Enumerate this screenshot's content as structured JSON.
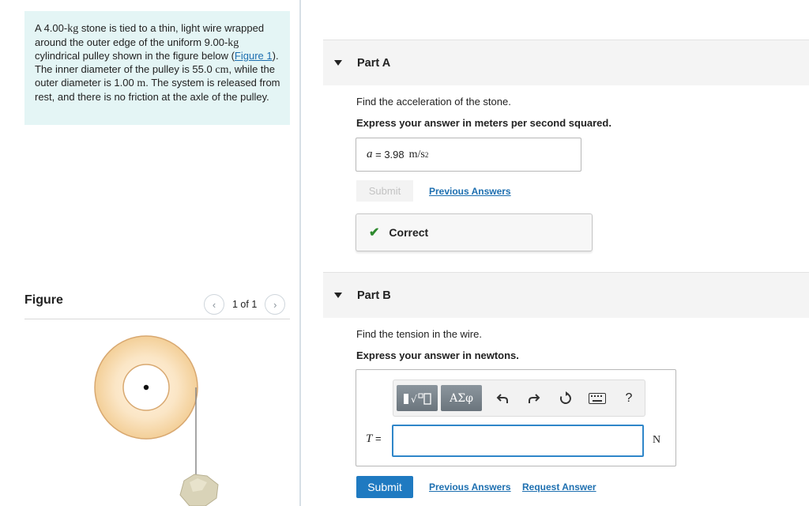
{
  "problem": {
    "text_1": "A 4.00-",
    "unit_kg_1": "kg",
    "text_2": " stone is tied to a thin, light wire wrapped around the outer edge of the uniform 9.00-",
    "unit_kg_2": "kg",
    "text_3": " cylindrical pulley shown in the figure below (",
    "figure_link": "Figure 1",
    "text_4": "). The inner diameter of the pulley is 55.0 ",
    "unit_cm": "cm",
    "text_5": ", while the outer diameter is 1.00 ",
    "unit_m": "m",
    "text_6": ". The system is released from rest, and there is no friction at the axle of the pulley."
  },
  "figure": {
    "title": "Figure",
    "pager_text": "1 of 1",
    "prev_icon": "chevron-left-icon",
    "next_icon": "chevron-right-icon",
    "colors": {
      "pulley_outer": "#f9e0bc",
      "pulley_stroke": "#d8a870",
      "stone": "#d9d3b8"
    }
  },
  "partA": {
    "title": "Part A",
    "question": "Find the acceleration of the stone.",
    "instruction": "Express your answer in meters per second squared.",
    "answer_var": "a",
    "answer_eq": " = ",
    "answer_value": "3.98",
    "answer_unit": "m/s",
    "answer_unit_sup": "2",
    "submit_label": "Submit",
    "previous_answers": "Previous Answers",
    "correct_label": "Correct"
  },
  "partB": {
    "title": "Part B",
    "question": "Find the tension in the wire.",
    "instruction": "Express your answer in newtons.",
    "var": "T",
    "eq": " = ",
    "input_value": "",
    "unit": "N",
    "toolbar": {
      "templates_icon": "templates-icon",
      "greek_label": "ΑΣφ",
      "undo_icon": "undo-icon",
      "redo_icon": "redo-icon",
      "reset_icon": "reset-icon",
      "keyboard_icon": "keyboard-icon",
      "help_label": "?"
    },
    "submit_label": "Submit",
    "previous_answers": "Previous Answers",
    "request_answer": "Request Answer"
  },
  "colors": {
    "accent": "#1f7ac1",
    "link": "#1d6fb0",
    "correct": "#2e8a2e",
    "problem_bg": "#e4f5f5"
  }
}
